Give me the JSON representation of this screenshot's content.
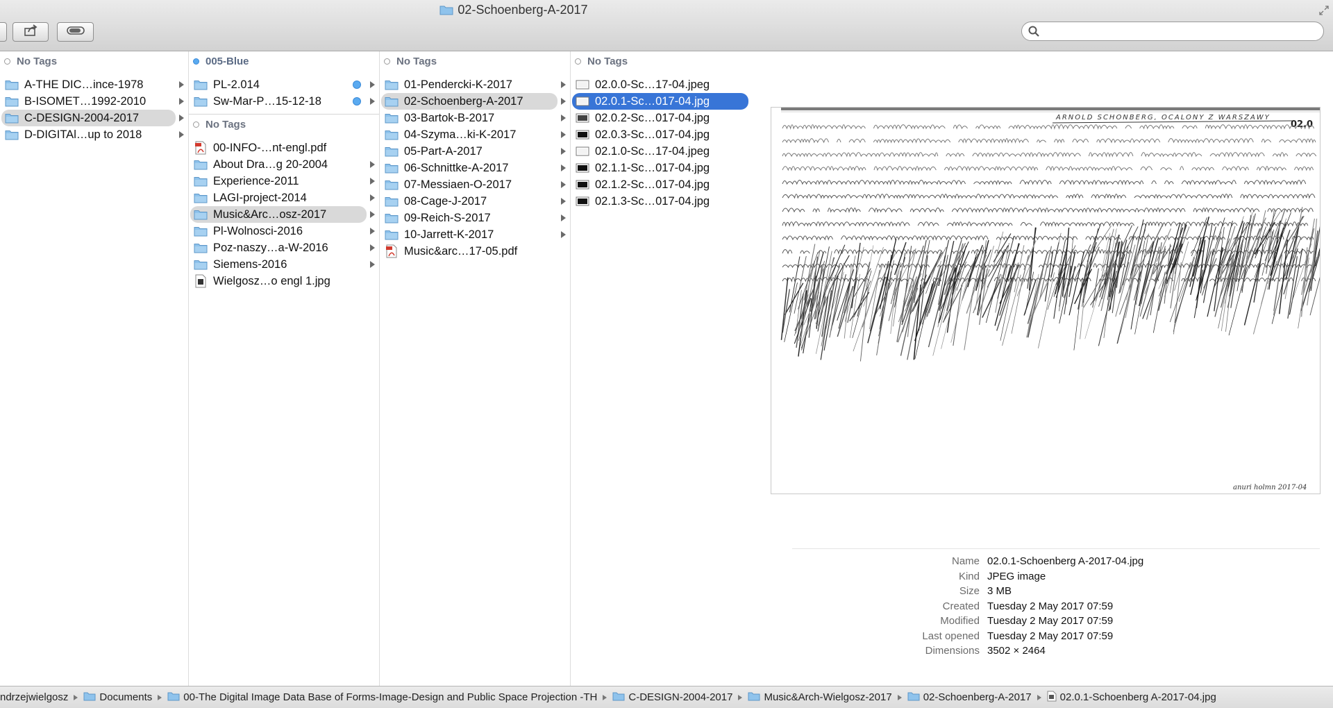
{
  "window": {
    "title": "02-Schoenberg-A-2017"
  },
  "search": {
    "placeholder": "",
    "value": ""
  },
  "columns": [
    {
      "sections": [
        {
          "tag": "No Tags",
          "tag_color": "none",
          "items": [
            {
              "label": "A-THE DIC…ince-1978",
              "type": "folder",
              "arrow": true
            },
            {
              "label": "B-ISOMET…1992-2010",
              "type": "folder",
              "arrow": true
            },
            {
              "label": "C-DESIGN-2004-2017",
              "type": "folder",
              "arrow": true,
              "selected": "gray"
            },
            {
              "label": "D-DIGITAl…up to 2018",
              "type": "folder",
              "arrow": true
            }
          ]
        }
      ]
    },
    {
      "sections": [
        {
          "tag": "005-Blue",
          "tag_color": "#5aaaf0",
          "items": [
            {
              "label": "PL-2.014",
              "type": "folder",
              "arrow": true,
              "tagdot": true
            },
            {
              "label": "Sw-Mar-P…15-12-18",
              "type": "folder",
              "arrow": true,
              "tagdot": true
            }
          ]
        },
        {
          "tag": "No Tags",
          "tag_color": "none",
          "items": [
            {
              "label": "00-INFO-…nt-engl.pdf",
              "type": "pdf",
              "arrow": false
            },
            {
              "label": "About Dra…g 20-2004",
              "type": "folder",
              "arrow": true
            },
            {
              "label": "Experience-2011",
              "type": "folder",
              "arrow": true
            },
            {
              "label": "LAGI-project-2014",
              "type": "folder",
              "arrow": true
            },
            {
              "label": "Music&Arc…osz-2017",
              "type": "folder",
              "arrow": true,
              "selected": "gray"
            },
            {
              "label": "Pl-Wolnosci-2016",
              "type": "folder",
              "arrow": true
            },
            {
              "label": "Poz-naszy…a-W-2016",
              "type": "folder",
              "arrow": true
            },
            {
              "label": "Siemens-2016",
              "type": "folder",
              "arrow": true
            },
            {
              "label": "Wielgosz…o engl 1.jpg",
              "type": "jpgdoc",
              "arrow": false
            }
          ]
        }
      ]
    },
    {
      "sections": [
        {
          "tag": "No Tags",
          "tag_color": "none",
          "items": [
            {
              "label": "01-Pendercki-K-2017",
              "type": "folder",
              "arrow": true
            },
            {
              "label": "02-Schoenberg-A-2017",
              "type": "folder",
              "arrow": true,
              "selected": "gray"
            },
            {
              "label": "03-Bartok-B-2017",
              "type": "folder",
              "arrow": true
            },
            {
              "label": "04-Szyma…ki-K-2017",
              "type": "folder",
              "arrow": true
            },
            {
              "label": "05-Part-A-2017",
              "type": "folder",
              "arrow": true
            },
            {
              "label": "06-Schnittke-A-2017",
              "type": "folder",
              "arrow": true
            },
            {
              "label": "07-Messiaen-O-2017",
              "type": "folder",
              "arrow": true
            },
            {
              "label": "08-Cage-J-2017",
              "type": "folder",
              "arrow": true
            },
            {
              "label": "09-Reich-S-2017",
              "type": "folder",
              "arrow": true
            },
            {
              "label": "10-Jarrett-K-2017",
              "type": "folder",
              "arrow": true
            },
            {
              "label": "Music&arc…17-05.pdf",
              "type": "pdf",
              "arrow": false
            }
          ]
        }
      ]
    },
    {
      "sections": [
        {
          "tag": "No Tags",
          "tag_color": "none",
          "items": [
            {
              "label": "02.0.0-Sc…17-04.jpeg",
              "type": "thumb-light",
              "arrow": false
            },
            {
              "label": "02.0.1-Sc…017-04.jpg",
              "type": "thumb-light",
              "arrow": false,
              "selected": "blue"
            },
            {
              "label": "02.0.2-Sc…017-04.jpg",
              "type": "thumb-mid",
              "arrow": false
            },
            {
              "label": "02.0.3-Sc…017-04.jpg",
              "type": "thumb-dark",
              "arrow": false
            },
            {
              "label": "02.1.0-Sc…17-04.jpeg",
              "type": "thumb-light",
              "arrow": false
            },
            {
              "label": "02.1.1-Sc…017-04.jpg",
              "type": "thumb-dark",
              "arrow": false
            },
            {
              "label": "02.1.2-Sc…017-04.jpg",
              "type": "thumb-dark",
              "arrow": false
            },
            {
              "label": "02.1.3-Sc…017-04.jpg",
              "type": "thumb-dark",
              "arrow": false
            }
          ]
        }
      ]
    }
  ],
  "preview": {
    "image_heading": "ARNOLD SCHONBERG, OCALONY Z WARSZAWY",
    "image_number": "02.0",
    "image_signature": "anuri holmn 2017-04",
    "info": [
      {
        "key": "Name",
        "value": "02.0.1-Schoenberg A-2017-04.jpg"
      },
      {
        "key": "Kind",
        "value": "JPEG image"
      },
      {
        "key": "Size",
        "value": "3 MB"
      },
      {
        "key": "Created",
        "value": "Tuesday 2 May 2017 07:59"
      },
      {
        "key": "Modified",
        "value": "Tuesday 2 May 2017 07:59"
      },
      {
        "key": "Last opened",
        "value": "Tuesday 2 May 2017 07:59"
      },
      {
        "key": "Dimensions",
        "value": "3502 × 2464"
      }
    ]
  },
  "path_bar": [
    {
      "label": "ndrzejwielgosz",
      "type": "home"
    },
    {
      "label": "Documents",
      "type": "folder"
    },
    {
      "label": "00-The Digital Image Data Base of Forms-Image-Design and Public Space Projection -TH",
      "type": "folder"
    },
    {
      "label": "C-DESIGN-2004-2017",
      "type": "folder"
    },
    {
      "label": "Music&Arch-Wielgosz-2017",
      "type": "folder"
    },
    {
      "label": "02-Schoenberg-A-2017",
      "type": "folder"
    },
    {
      "label": "02.0.1-Schoenberg A-2017-04.jpg",
      "type": "file"
    }
  ],
  "colors": {
    "selection_blue": "#3875d7",
    "selection_gray": "#d9d9d9",
    "folder_blue": "#8fc3ec",
    "tag_blue": "#5aaaf0"
  }
}
